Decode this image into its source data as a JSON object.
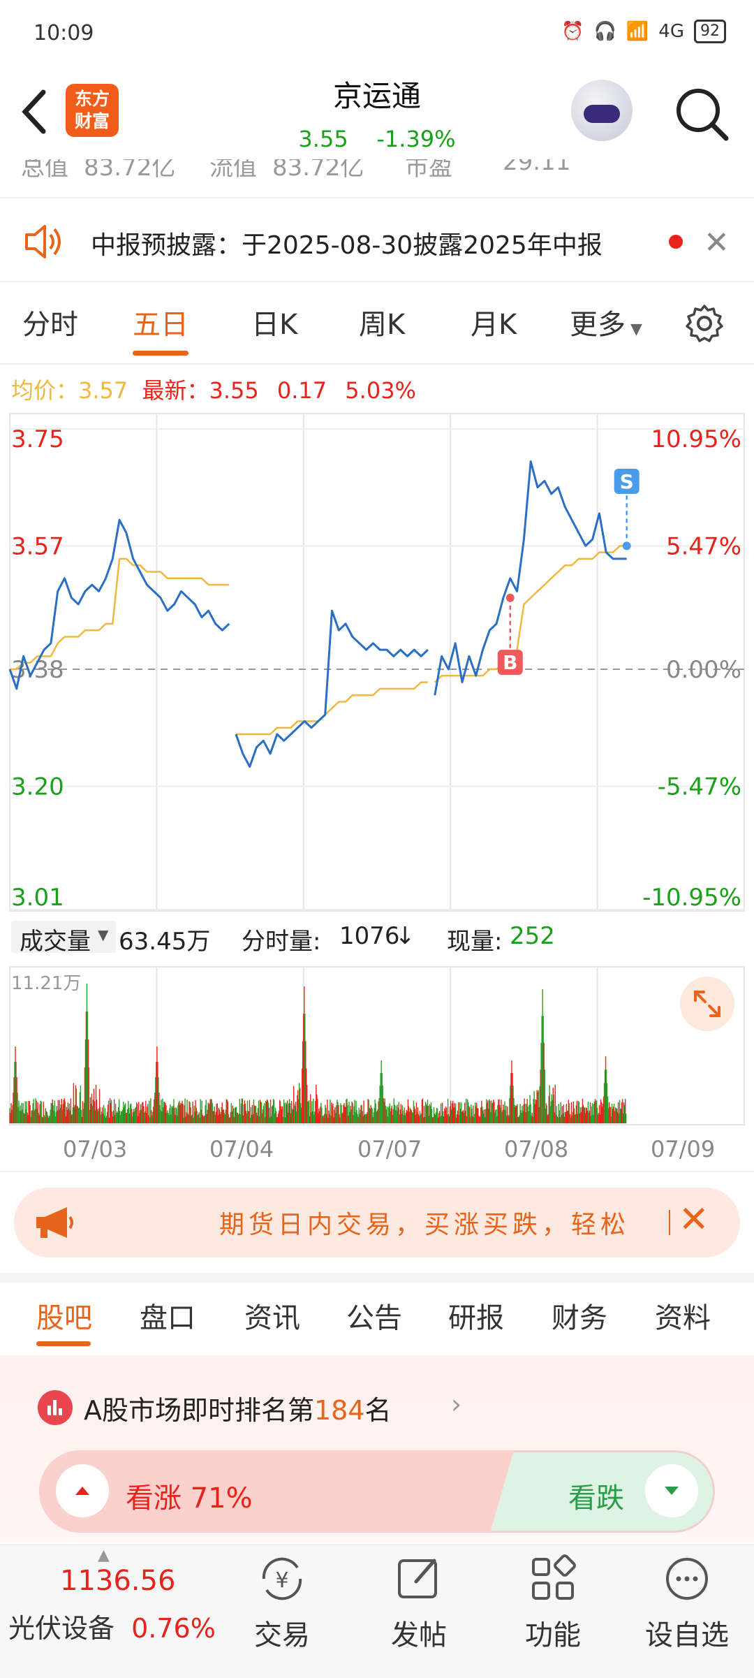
{
  "status_bar": {
    "time": "10:09",
    "network": "4G",
    "battery": "92"
  },
  "header": {
    "logo_line1": "东方",
    "logo_line2": "财富",
    "stock_name": "京运通",
    "price": "3.55",
    "change_pct": "-1.39%"
  },
  "partial_row": [
    "总值",
    "83.72亿",
    "流值",
    "83.72亿",
    "市盈",
    "29.11"
  ],
  "notice": {
    "text": "中报预披露：于2025-08-30披露2025年中报"
  },
  "period_tabs": [
    "分时",
    "五日",
    "日K",
    "周K",
    "月K",
    "更多"
  ],
  "active_period": "五日",
  "info_line": {
    "avg_label": "均价：",
    "avg_value": "3.57",
    "latest_label": "最新：",
    "latest_value": "3.55",
    "change": "0.17",
    "change_pct": "5.03%"
  },
  "chart_data": {
    "type": "line",
    "title": "",
    "price_axis": [
      "3.75",
      "3.57",
      "3.38",
      "3.20",
      "3.01"
    ],
    "pct_axis": [
      "10.95%",
      "5.47%",
      "0.00%",
      "-5.47%",
      "-10.95%"
    ],
    "ylim": [
      3.01,
      3.75
    ],
    "prev_close": 3.38,
    "days": [
      "07/03",
      "07/04",
      "07/07",
      "07/08",
      "07/09"
    ],
    "price_series": [
      3.38,
      3.35,
      3.4,
      3.37,
      3.39,
      3.41,
      3.42,
      3.5,
      3.52,
      3.49,
      3.48,
      3.5,
      3.51,
      3.5,
      3.52,
      3.55,
      3.61,
      3.59,
      3.55,
      3.53,
      3.51,
      3.5,
      3.49,
      3.47,
      3.48,
      3.5,
      3.49,
      3.48,
      3.46,
      3.47,
      3.45,
      3.44,
      3.45,
      3.28,
      3.25,
      3.23,
      3.26,
      3.27,
      3.25,
      3.28,
      3.27,
      3.28,
      3.29,
      3.3,
      3.29,
      3.3,
      3.31,
      3.47,
      3.44,
      3.45,
      3.43,
      3.42,
      3.41,
      3.42,
      3.41,
      3.41,
      3.4,
      3.41,
      3.4,
      3.41,
      3.4,
      3.41,
      3.34,
      3.4,
      3.38,
      3.42,
      3.36,
      3.4,
      3.37,
      3.41,
      3.44,
      3.45,
      3.49,
      3.52,
      3.5,
      3.58,
      3.7,
      3.66,
      3.67,
      3.65,
      3.66,
      3.63,
      3.61,
      3.59,
      3.57,
      3.58,
      3.62,
      3.56,
      3.55,
      3.55,
      3.55
    ],
    "avg_series": [
      3.38,
      3.38,
      3.39,
      3.39,
      3.4,
      3.4,
      3.4,
      3.42,
      3.43,
      3.43,
      3.43,
      3.44,
      3.44,
      3.44,
      3.45,
      3.45,
      3.55,
      3.55,
      3.54,
      3.54,
      3.53,
      3.53,
      3.53,
      3.52,
      3.52,
      3.52,
      3.52,
      3.52,
      3.52,
      3.51,
      3.51,
      3.51,
      3.51,
      3.28,
      3.28,
      3.28,
      3.28,
      3.28,
      3.28,
      3.29,
      3.29,
      3.29,
      3.3,
      3.3,
      3.3,
      3.3,
      3.31,
      3.32,
      3.33,
      3.33,
      3.34,
      3.34,
      3.34,
      3.34,
      3.35,
      3.35,
      3.35,
      3.35,
      3.35,
      3.35,
      3.36,
      3.36,
      3.36,
      3.37,
      3.37,
      3.37,
      3.37,
      3.37,
      3.37,
      3.37,
      3.38,
      3.38,
      3.39,
      3.4,
      3.41,
      3.48,
      3.49,
      3.5,
      3.51,
      3.52,
      3.53,
      3.54,
      3.54,
      3.55,
      3.55,
      3.55,
      3.56,
      3.56,
      3.56,
      3.57,
      3.57
    ],
    "markers": [
      {
        "label": "B",
        "price": 3.49,
        "day": "07/08"
      },
      {
        "label": "S",
        "price": 3.57,
        "day": "07/08"
      }
    ]
  },
  "volume": {
    "selector_label": "成交量",
    "total": "63.45万",
    "minute_vol_label": "分时量:",
    "minute_vol": "1076",
    "current_vol_label": "现量:",
    "current_vol": "252",
    "max_label": "11.21万"
  },
  "ad": {
    "text": "期货日内交易，买涨买跌，轻松"
  },
  "content_tabs": [
    "股吧",
    "盘口",
    "资讯",
    "公告",
    "研报",
    "财务",
    "资料"
  ],
  "active_content_tab": "股吧",
  "rank": {
    "prefix": "A股市场即时排名第",
    "number": "184",
    "suffix": "名"
  },
  "sentiment": {
    "up_label": "看涨",
    "up_pct": "71%",
    "down_label": "看跌",
    "up_fraction": 0.71
  },
  "bottom_bar": {
    "index_value": "1136.56",
    "index_name": "光伏设备",
    "index_change": "0.76%",
    "nav": [
      "交易",
      "发帖",
      "功能",
      "设自选"
    ]
  },
  "colors": {
    "accent": "#e8641a",
    "up": "#e8231c",
    "down": "#1aa01a",
    "price_line": "#2a6fc4",
    "avg_line": "#f0b840"
  }
}
